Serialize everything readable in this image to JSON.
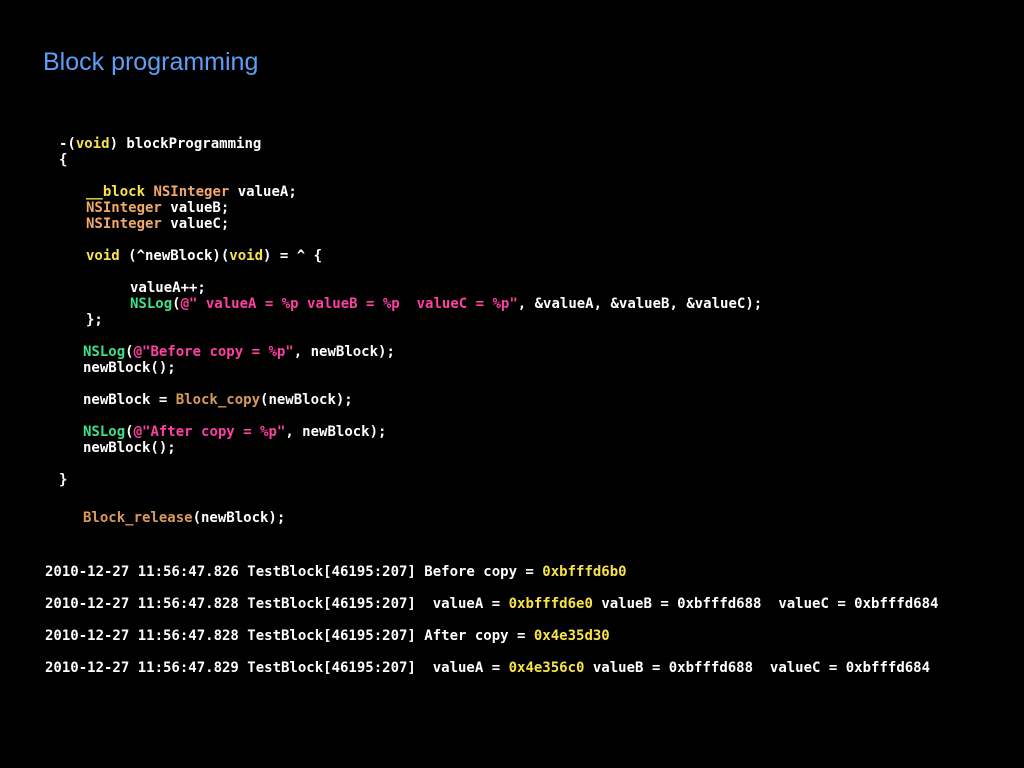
{
  "title": "Block programming",
  "colors": {
    "background": "#000000",
    "title": "#5c9ff5",
    "keyword": "#f7e34a",
    "type": "#f2a86b",
    "function": "#3ee08a",
    "string": "#ff3fa2",
    "c_function": "#d99a5b",
    "highlight": "#f7e34a"
  },
  "code": {
    "l01": {
      "a": "-(",
      "b": "void",
      "c": ") blockProgramming"
    },
    "l02": {
      "a": "{"
    },
    "l03": {
      "a": "__block",
      "b": " ",
      "c": "NSInteger",
      "d": " valueA;"
    },
    "l04": {
      "a": "NSInteger",
      "b": " valueB;"
    },
    "l05": {
      "a": "NSInteger",
      "b": " valueC;"
    },
    "l06": {
      "a": "void",
      "b": " (^newBlock)(",
      "c": "void",
      "d": ") = ^ {"
    },
    "l07": {
      "a": "valueA++;"
    },
    "l08": {
      "a": "NSLog",
      "b": "(",
      "c": "@\" valueA = %p valueB = %p  valueC = %p\"",
      "d": ", &valueA, &valueB, &valueC);"
    },
    "l09": {
      "a": "};"
    },
    "l10": {
      "a": "NSLog",
      "b": "(",
      "c": "@\"Before copy = %p\"",
      "d": ", newBlock);"
    },
    "l11": {
      "a": "newBlock();"
    },
    "l12": {
      "a": "newBlock = ",
      "b": "Block_copy",
      "c": "(newBlock);"
    },
    "l13": {
      "a": "NSLog",
      "b": "(",
      "c": "@\"After copy = %p\"",
      "d": ", newBlock);"
    },
    "l14": {
      "a": "newBlock();"
    },
    "l15": {
      "a": "}"
    },
    "l16": {
      "a": "Block_release",
      "b": "(newBlock);"
    }
  },
  "output": {
    "o1": {
      "a": "2010-12-27 11:56:47.826 TestBlock[46195:207] Before copy = ",
      "b": "0xbfffd6b0"
    },
    "o2": {
      "a": "2010-12-27 11:56:47.828 TestBlock[46195:207]  valueA = ",
      "b": "0xbfffd6e0",
      "c": " valueB = 0xbfffd688  valueC = 0xbfffd684"
    },
    "o3": {
      "a": "2010-12-27 11:56:47.828 TestBlock[46195:207] After copy = ",
      "b": "0x4e35d30"
    },
    "o4": {
      "a": "2010-12-27 11:56:47.829 TestBlock[46195:207]  valueA = ",
      "b": "0x4e356c0",
      "c": " valueB = 0xbfffd688  valueC = 0xbfffd684"
    }
  }
}
